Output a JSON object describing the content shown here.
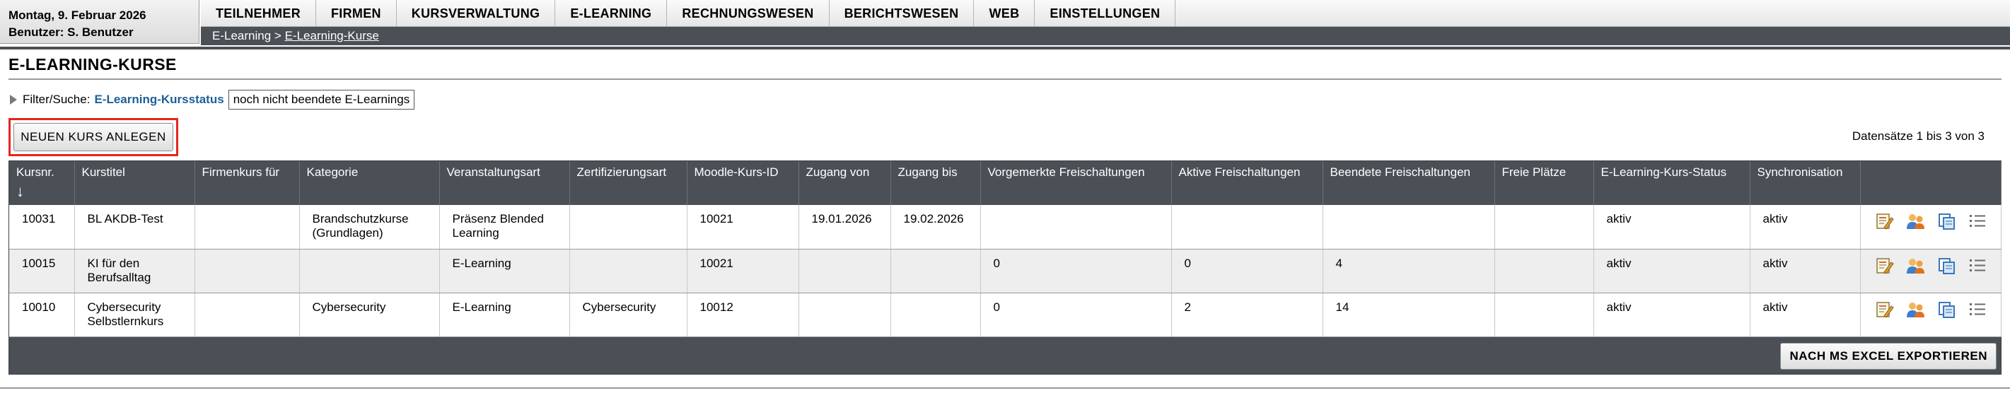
{
  "header": {
    "date": "Montag, 9. Februar 2026",
    "user": "Benutzer: S. Benutzer"
  },
  "menu": [
    "TEILNEHMER",
    "FIRMEN",
    "KURSVERWALTUNG",
    "E-LEARNING",
    "RECHNUNGSWESEN",
    "BERICHTSWESEN",
    "WEB",
    "EINSTELLUNGEN"
  ],
  "breadcrumb": {
    "parent": "E-Learning",
    "separator": ">",
    "current": "E-Learning-Kurse"
  },
  "page": {
    "title": "E-LEARNING-KURSE"
  },
  "filter": {
    "label": "Filter/Suche:",
    "key": "E-Learning-Kursstatus",
    "value": "noch nicht beendete E-Learnings"
  },
  "actions": {
    "new_course": "NEUEN KURS ANLEGEN",
    "records": "Datensätze 1 bis 3 von 3",
    "export": "NACH MS EXCEL EXPORTIEREN"
  },
  "table": {
    "sort_arrow": "↓",
    "columns": [
      "Kursnr.",
      "Kurstitel",
      "Firmenkurs für",
      "Kategorie",
      "Veranstaltungsart",
      "Zertifizierungsart",
      "Moodle-Kurs-ID",
      "Zugang von",
      "Zugang bis",
      "Vorgemerkte Freischaltungen",
      "Aktive Freischaltungen",
      "Beendete Freischaltungen",
      "Freie Plätze",
      "E-Learning-Kurs-Status",
      "Synchronisation",
      ""
    ],
    "rows": [
      [
        "10031",
        "BL AKDB-Test",
        "",
        "Brandschutzkurse (Grundlagen)",
        "Präsenz Blended Learning",
        "",
        "10021",
        "19.01.2026",
        "19.02.2026",
        "",
        "",
        "",
        "",
        "aktiv",
        "aktiv"
      ],
      [
        "10015",
        "KI für den Berufsalltag",
        "",
        "",
        "E-Learning",
        "",
        "10021",
        "",
        "",
        "0",
        "0",
        "4",
        "",
        "aktiv",
        "aktiv"
      ],
      [
        "10010",
        "Cybersecurity Selbstlernkurs",
        "",
        "Cybersecurity",
        "E-Learning",
        "Cybersecurity",
        "10012",
        "",
        "",
        "0",
        "2",
        "14",
        "",
        "aktiv",
        "aktiv"
      ]
    ],
    "row_icons": [
      "edit-icon",
      "participants-icon",
      "copy-icon",
      "list-icon"
    ]
  },
  "colors": {
    "dark_bar": "#4a5055",
    "link": "#1f5f95",
    "highlight": "#e4261e"
  }
}
